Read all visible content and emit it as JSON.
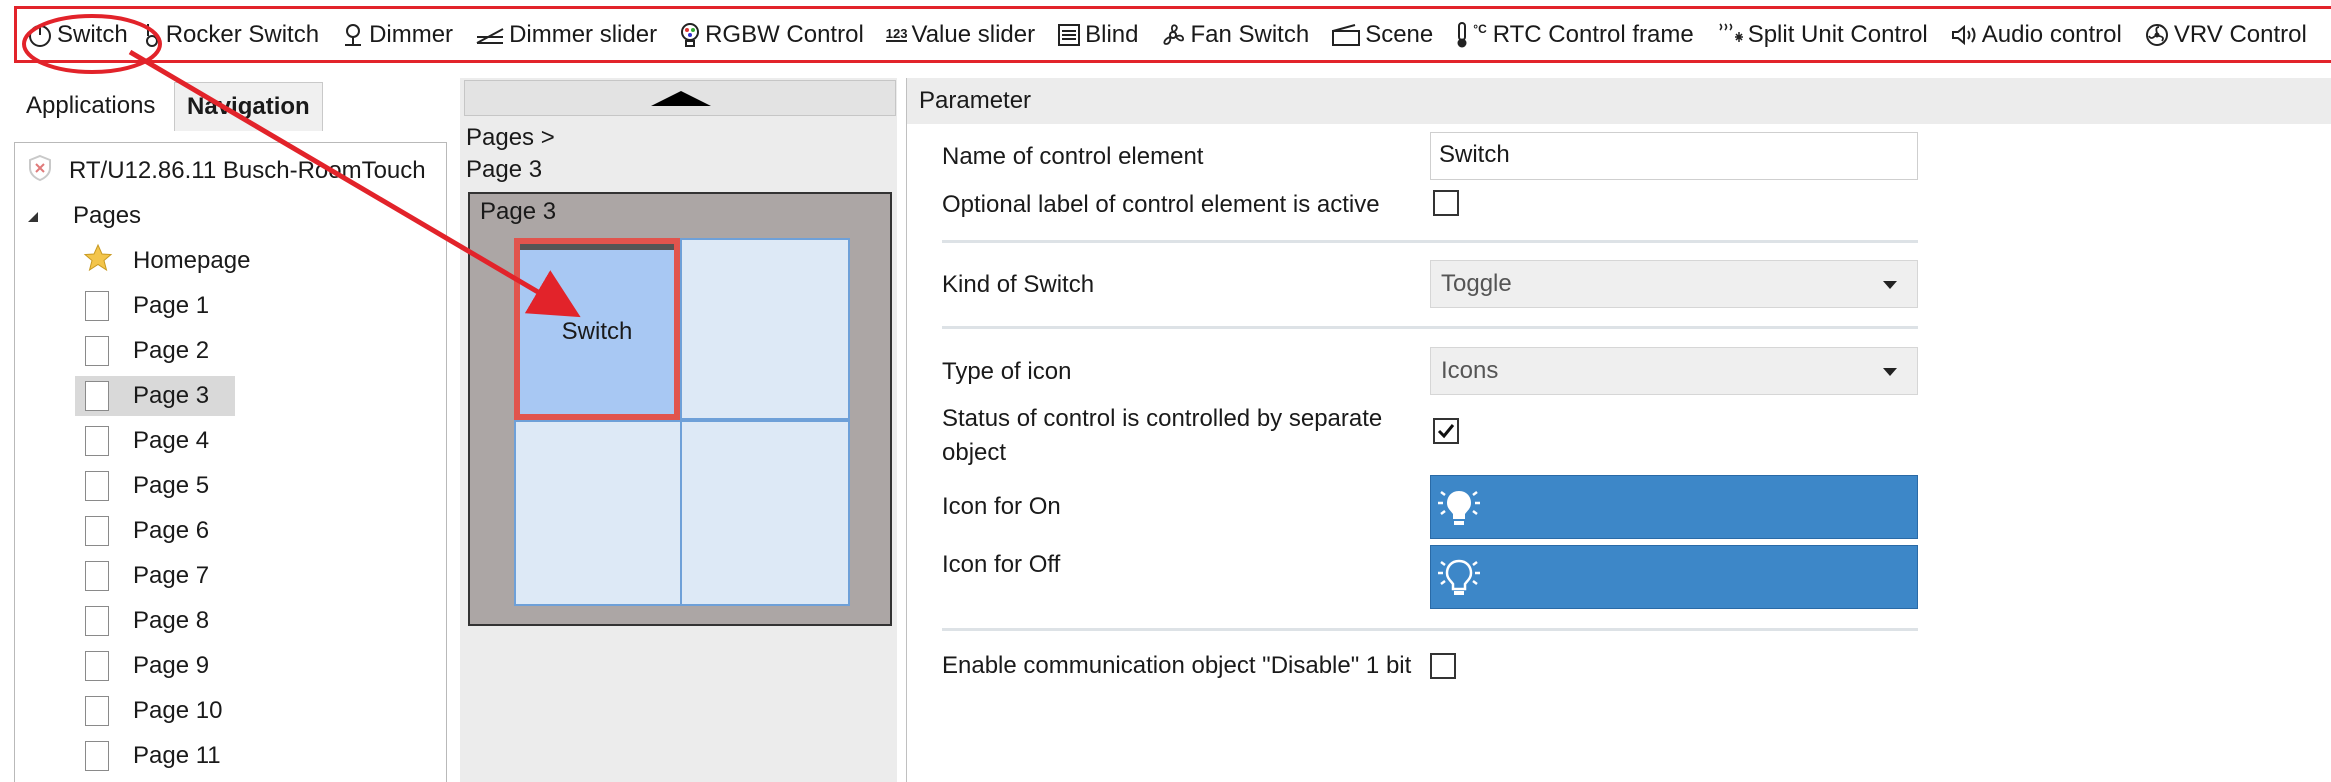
{
  "toolbar": {
    "items": [
      {
        "label": "Switch",
        "icon": "power-icon"
      },
      {
        "label": "Rocker Switch",
        "icon": "rocker-switch-icon"
      },
      {
        "label": "Dimmer",
        "icon": "dimmer-icon"
      },
      {
        "label": "Dimmer slider",
        "icon": "dimmer-slider-icon"
      },
      {
        "label": "RGBW Control",
        "icon": "rgbw-bulb-icon"
      },
      {
        "label": "Value slider",
        "icon": "value-123-icon",
        "icon_text": "123"
      },
      {
        "label": "Blind",
        "icon": "blind-icon"
      },
      {
        "label": "Fan Switch",
        "icon": "fan-icon"
      },
      {
        "label": "Scene",
        "icon": "scene-icon"
      },
      {
        "label": "RTC Control frame",
        "icon": "thermometer-icon",
        "icon_text": "°C"
      },
      {
        "label": "Split Unit Control",
        "icon": "split-unit-icon"
      },
      {
        "label": "Audio control",
        "icon": "speaker-icon"
      },
      {
        "label": "VRV Control",
        "icon": "vrv-fan-icon"
      }
    ]
  },
  "left": {
    "tabs": {
      "applications": "Applications",
      "navigation": "Navigation"
    },
    "tree": {
      "device": "RT/U12.86.11 Busch-RoomTouch",
      "pages_label": "Pages",
      "homepage": "Homepage",
      "pages": [
        "Page 1",
        "Page 2",
        "Page 3",
        "Page 4",
        "Page 5",
        "Page 6",
        "Page 7",
        "Page 8",
        "Page 9",
        "Page 10",
        "Page 11"
      ],
      "selected": "Page 3"
    }
  },
  "middle": {
    "breadcrumb_line1": "Pages >",
    "breadcrumb_line2": "Page 3",
    "grid_title": "Page 3",
    "cell_label": "Switch"
  },
  "right": {
    "header": "Parameter",
    "params": {
      "name_label": "Name of control element",
      "name_value": "Switch",
      "optional_label": "Optional label of control element is active",
      "optional_checked": false,
      "kind_label": "Kind of Switch",
      "kind_value": "Toggle",
      "type_icon_label": "Type of icon",
      "type_icon_value": "Icons",
      "status_label_line1": "Status of control is controlled by separate",
      "status_label_line2": "object",
      "status_checked": true,
      "icon_on_label": "Icon for On",
      "icon_off_label": "Icon for Off",
      "disable_label": "Enable communication object \"Disable\" 1 bit",
      "disable_checked": false
    }
  },
  "colors": {
    "accent_red": "#e2232a",
    "icon_box_blue": "#3d87c8",
    "cell_selected_blue": "#a8c8f3",
    "cell_border_red": "#e1544d"
  }
}
